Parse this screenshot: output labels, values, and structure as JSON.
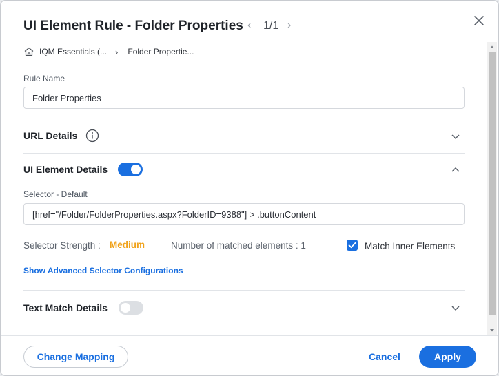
{
  "header": {
    "title": "UI Element Rule - Folder Properties",
    "pager": {
      "prev_icon": "chevron-left-icon",
      "count": "1/1",
      "next_icon": "chevron-right-icon"
    },
    "close_icon": "close-icon"
  },
  "breadcrumb": {
    "home_icon": "home-icon",
    "items": [
      "IQM Essentials (...",
      "Folder Propertie..."
    ],
    "separator_icon": "chevron-right-icon"
  },
  "form": {
    "rule_name_label": "Rule Name",
    "rule_name_value": "Folder Properties",
    "url_details": {
      "title": "URL Details",
      "info_icon": "info-icon",
      "expanded": false
    },
    "ui_element_details": {
      "title": "UI Element Details",
      "enabled": true,
      "expanded": true,
      "selector_label": "Selector - Default",
      "selector_value": "[href=\"/Folder/FolderProperties.aspx?FolderID=9388\"] > .buttonContent",
      "strength_label": "Selector Strength :",
      "strength_value": "Medium",
      "matched_label": "Number of matched elements : 1",
      "match_inner_label": "Match Inner Elements",
      "match_inner_checked": true,
      "advanced_link": "Show Advanced Selector Configurations"
    },
    "text_match_details": {
      "title": "Text Match Details",
      "enabled": false,
      "expanded": false
    }
  },
  "footer": {
    "change_mapping": "Change Mapping",
    "cancel": "Cancel",
    "apply": "Apply"
  },
  "colors": {
    "accent": "#1a6fe0",
    "strength_medium": "#f0a21a",
    "toggle_off": "#dcdfe3"
  }
}
